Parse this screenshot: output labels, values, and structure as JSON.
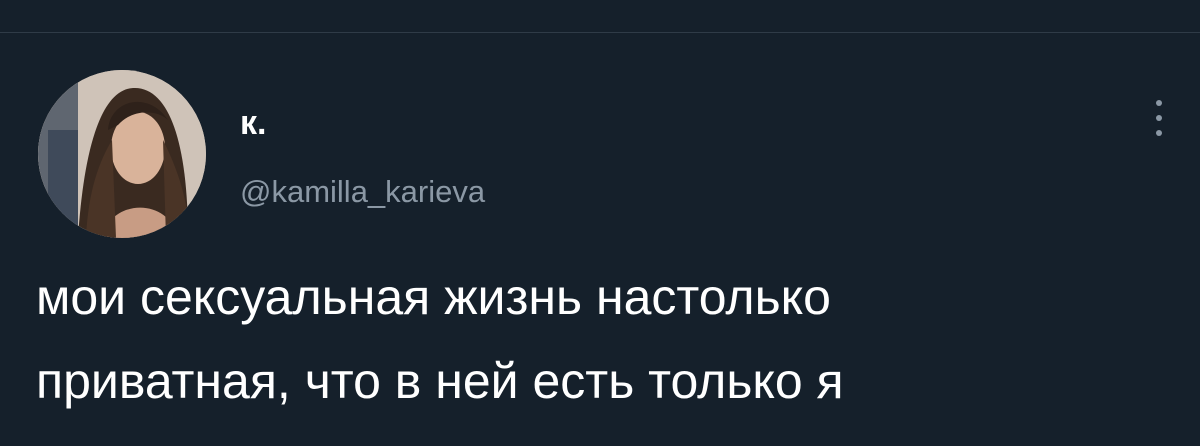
{
  "tweet": {
    "author": {
      "display_name": "к.",
      "handle": "@kamilla_karieva",
      "avatar_icon": "user-avatar-photo"
    },
    "text": "мои сексуальная жизнь настолько\nприватная, что в ней есть только я",
    "menu_icon": "more-vertical-icon"
  },
  "colors": {
    "background": "#15202b",
    "text_primary": "#ffffff",
    "text_secondary": "#8b98a5",
    "divider": "#2f3b47"
  }
}
